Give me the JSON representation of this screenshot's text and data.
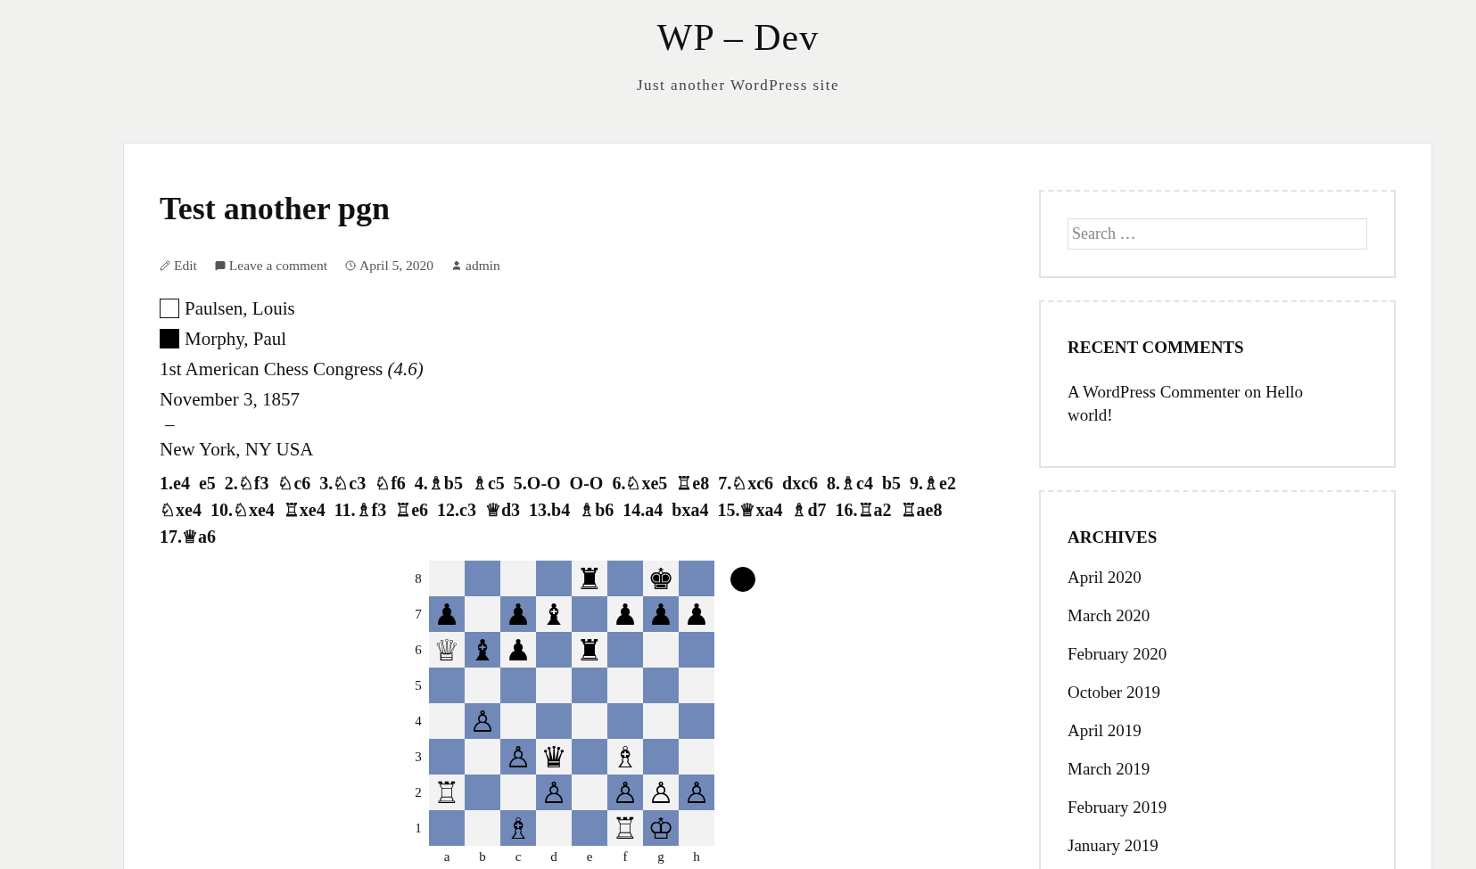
{
  "site": {
    "title": "WP – Dev",
    "tagline": "Just another WordPress site"
  },
  "post": {
    "title": "Test another pgn",
    "meta": [
      {
        "kind": "edit",
        "label": "Edit"
      },
      {
        "kind": "comment",
        "label": "Leave a comment"
      },
      {
        "kind": "date",
        "label": "April 5, 2020"
      },
      {
        "kind": "author",
        "label": "admin"
      }
    ],
    "players": [
      {
        "filled": false,
        "name": "Paulsen, Louis"
      },
      {
        "filled": true,
        "name": "Morphy, Paul"
      }
    ],
    "event": "1st American Chess Congress *(4.6)*",
    "date": "November 3, 1857",
    "result": "–",
    "location": "New York, NY USA",
    "moves": "1.e4 e5 2.♘f3 ♘c6 3.♘c3 ♘f6 4.♗b5 ♗c5 5.O-O O-O 6.♘xe5 ♖e8 7.♘xc6 dxc6 8.♗c4 b5 9.♗e2 ♘xe4 10.♘xe4 ♖xe4 11.♗f3 ♖e6 12.c3 ♕d3 13.b4 ♗b6 14.a4 bxa4 15.♕xa4 ♗d7 16.♖a2 ♖ae8 17.♕a6",
    "board": {
      "black_to_move": true,
      "files": [
        "a",
        "b",
        "c",
        "d",
        "e",
        "f",
        "g",
        "h"
      ],
      "rows": [
        {
          "rank": "8",
          "squares": [
            {
              "kind": "empty"
            },
            {
              "kind": "empty"
            },
            {
              "kind": "empty"
            },
            {
              "kind": "empty"
            },
            {
              "kind": "piece",
              "piece": "♜"
            },
            {
              "kind": "empty"
            },
            {
              "kind": "piece",
              "piece": "♚"
            },
            {
              "kind": "empty"
            }
          ]
        },
        {
          "rank": "7",
          "squares": [
            {
              "kind": "piece",
              "piece": "♟"
            },
            {
              "kind": "empty"
            },
            {
              "kind": "piece",
              "piece": "♟"
            },
            {
              "kind": "piece",
              "piece": "♝"
            },
            {
              "kind": "empty"
            },
            {
              "kind": "piece",
              "piece": "♟"
            },
            {
              "kind": "piece",
              "piece": "♟"
            },
            {
              "kind": "piece",
              "piece": "♟"
            }
          ]
        },
        {
          "rank": "6",
          "squares": [
            {
              "kind": "piece",
              "piece": "♕"
            },
            {
              "kind": "piece",
              "piece": "♝"
            },
            {
              "kind": "piece",
              "piece": "♟"
            },
            {
              "kind": "empty"
            },
            {
              "kind": "piece",
              "piece": "♜"
            },
            {
              "kind": "empty"
            },
            {
              "kind": "empty"
            },
            {
              "kind": "empty"
            }
          ]
        },
        {
          "rank": "5",
          "squares": [
            {
              "kind": "empty"
            },
            {
              "kind": "empty"
            },
            {
              "kind": "empty"
            },
            {
              "kind": "empty"
            },
            {
              "kind": "empty"
            },
            {
              "kind": "empty"
            },
            {
              "kind": "empty"
            },
            {
              "kind": "empty"
            }
          ]
        },
        {
          "rank": "4",
          "squares": [
            {
              "kind": "empty"
            },
            {
              "kind": "piece",
              "piece": "♙"
            },
            {
              "kind": "empty"
            },
            {
              "kind": "empty"
            },
            {
              "kind": "empty"
            },
            {
              "kind": "empty"
            },
            {
              "kind": "empty"
            },
            {
              "kind": "empty"
            }
          ]
        },
        {
          "rank": "3",
          "squares": [
            {
              "kind": "empty"
            },
            {
              "kind": "empty"
            },
            {
              "kind": "piece",
              "piece": "♙"
            },
            {
              "kind": "piece",
              "piece": "♛"
            },
            {
              "kind": "empty"
            },
            {
              "kind": "piece",
              "piece": "♗"
            },
            {
              "kind": "empty"
            },
            {
              "kind": "empty"
            }
          ]
        },
        {
          "rank": "2",
          "squares": [
            {
              "kind": "piece",
              "piece": "♖"
            },
            {
              "kind": "empty"
            },
            {
              "kind": "empty"
            },
            {
              "kind": "piece",
              "piece": "♙"
            },
            {
              "kind": "empty"
            },
            {
              "kind": "piece",
              "piece": "♙"
            },
            {
              "kind": "piece",
              "piece": "♙"
            },
            {
              "kind": "piece",
              "piece": "♙"
            }
          ]
        },
        {
          "rank": "1",
          "squares": [
            {
              "kind": "empty"
            },
            {
              "kind": "empty"
            },
            {
              "kind": "piece",
              "piece": "♗"
            },
            {
              "kind": "empty"
            },
            {
              "kind": "empty"
            },
            {
              "kind": "piece",
              "piece": "♖"
            },
            {
              "kind": "piece",
              "piece": "♔"
            },
            {
              "kind": "empty"
            }
          ]
        }
      ]
    }
  },
  "sidebar": {
    "search": {
      "placeholder": "Search …"
    },
    "recent_comments": {
      "title": "RECENT COMMENTS",
      "items": [
        "A WordPress Commenter on Hello world!"
      ]
    },
    "archives": {
      "title": "ARCHIVES",
      "items": [
        "April 2020",
        "March 2020",
        "February 2020",
        "October 2019",
        "April 2019",
        "March 2019",
        "February 2019",
        "January 2019"
      ]
    }
  }
}
